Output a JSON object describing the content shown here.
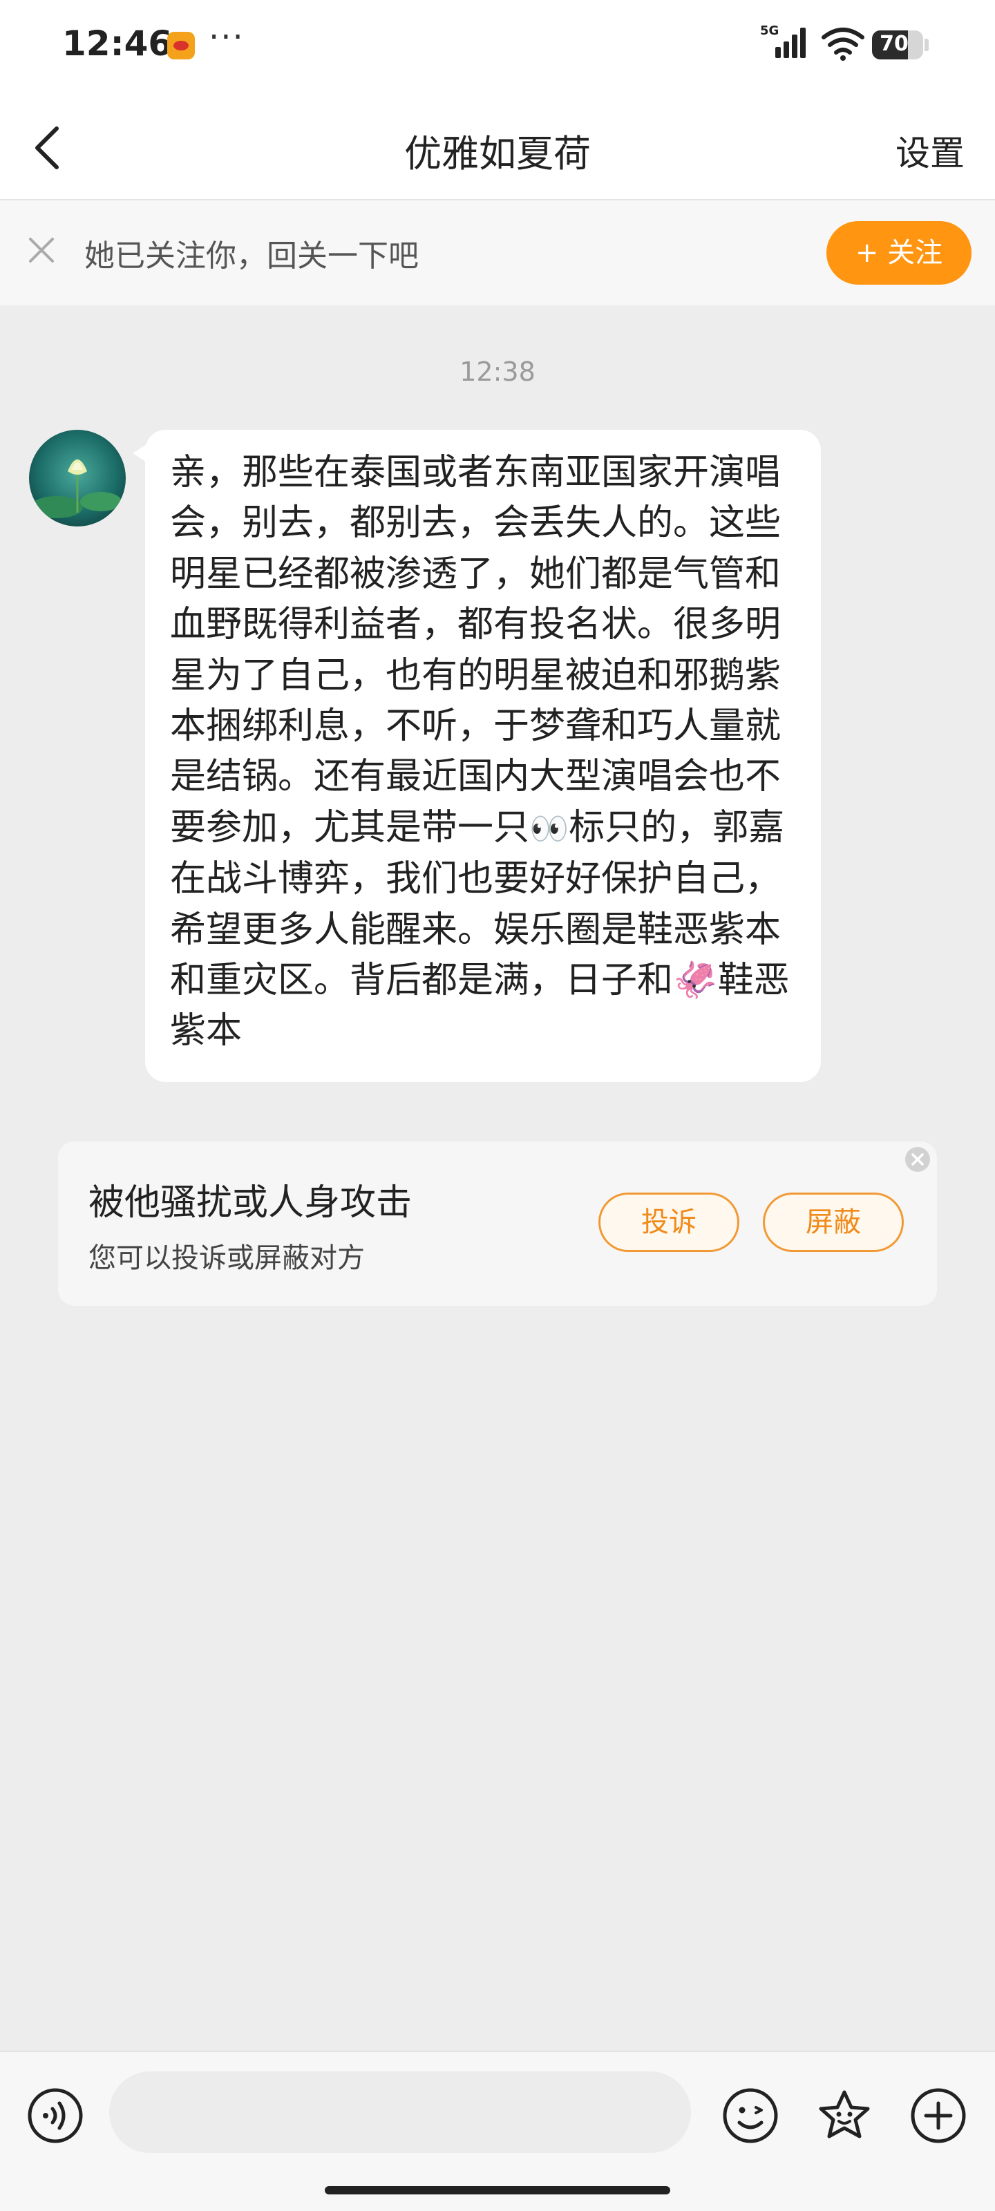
{
  "status_bar": {
    "time": "12:46",
    "more": "···",
    "network": "5G",
    "battery": 70
  },
  "nav": {
    "title": "优雅如夏荷",
    "settings": "设置"
  },
  "follow_banner": {
    "message": "她已关注你，回关一下吧",
    "button": "+ 关注",
    "accent": "#ff9510"
  },
  "chat": {
    "timestamp": "12:38",
    "message_parts": [
      "亲，那些在泰国或者东南亚国家开演唱会，别去，都别去，会丢失人的。这些明星已经都被渗透了，她们都是气管和血野既得利益者，都有投名状。很多明星为了自己，也有的明星被迫和邪鹅紫本捆绑利息，不听，于梦聋和巧人量就是结锅。还有最近国内大型演唱会也不要参加，尤其是带一只",
      "👀",
      "标只的，郭嘉在战斗博弈，我们也要好好保护自己，希望更多人能醒来。娱乐圈是鞋恶紫本和重灾区。背后都是满，日子和",
      "🦑",
      "鞋恶紫本"
    ]
  },
  "report_card": {
    "heading": "被他骚扰或人身攻击",
    "sub": "您可以投诉或屏蔽对方",
    "report_button": "投诉",
    "block_button": "屏蔽"
  },
  "input_bar": {
    "icons": [
      "voice-icon",
      "emoji-icon",
      "sticker-icon",
      "plus-icon"
    ]
  }
}
